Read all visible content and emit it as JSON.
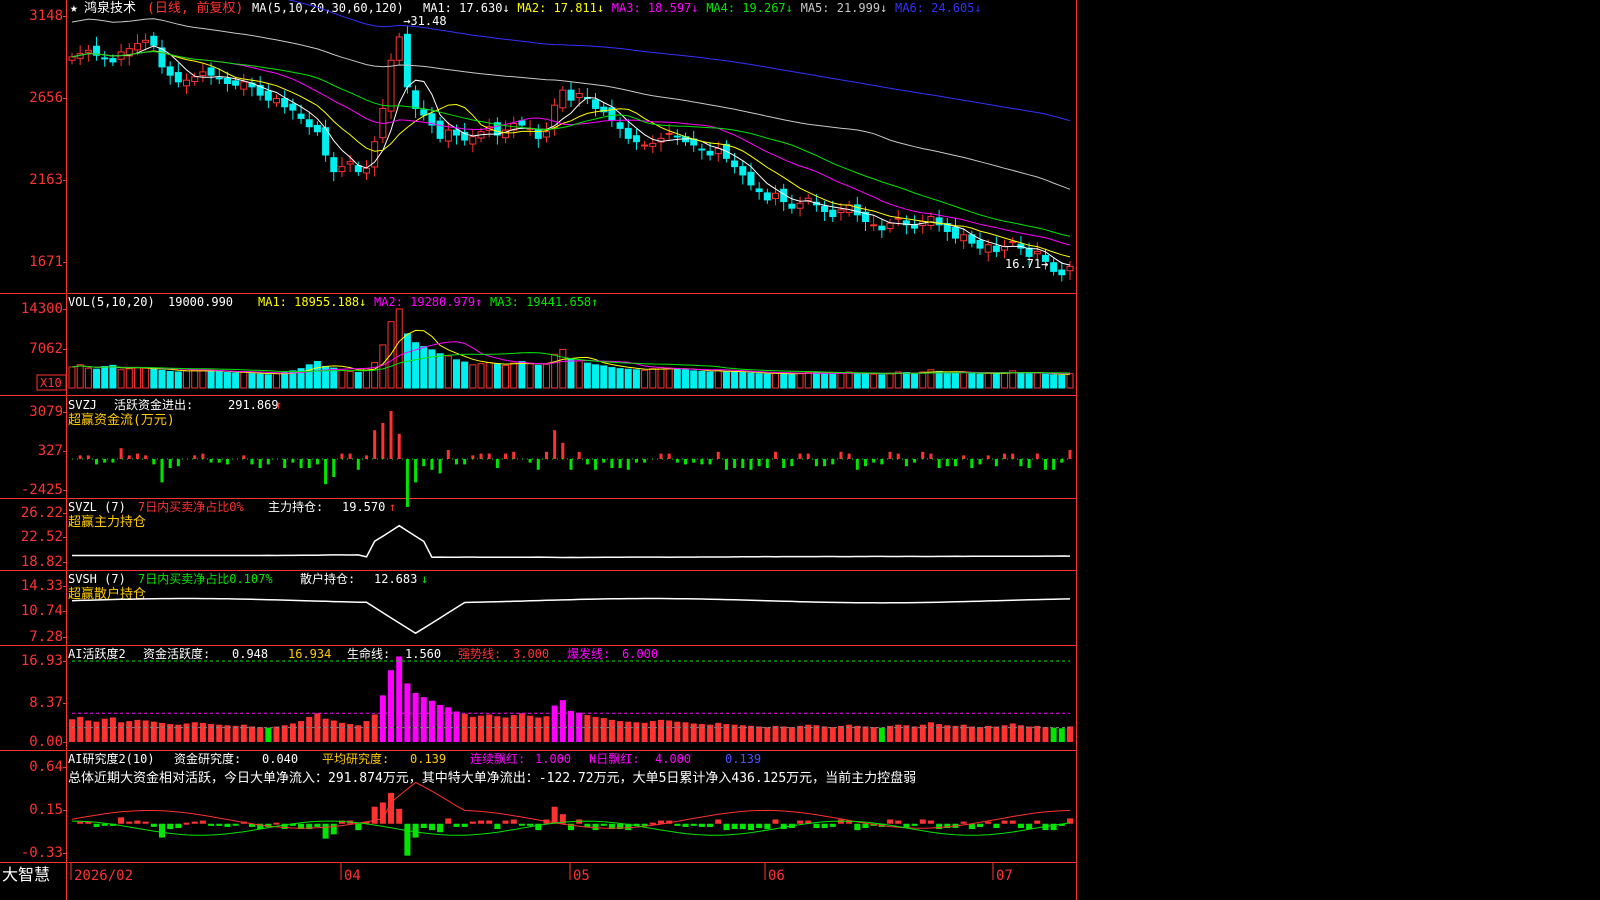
{
  "colors": {
    "up": "#ff3232",
    "down": "#00f0f0",
    "axis": "#ff3232",
    "ma1": "#ffffff",
    "ma2": "#ffff00",
    "ma3": "#ff00ff",
    "ma4": "#00e600",
    "ma5": "#c8c8c8",
    "ma6": "#3232ff",
    "green": "#00e600",
    "magenta": "#ff00ff",
    "gold": "#ffcc00",
    "grid": "#8b0000"
  },
  "header": {
    "stock_name": "鸿泉技术",
    "mode": "(日线, 前复权)",
    "ma_label": "MA(5,10,20,30,60,120)",
    "ma": [
      {
        "k": "MA1:",
        "v": "17.630",
        "arrow": "↓"
      },
      {
        "k": "MA2:",
        "v": "17.811",
        "arrow": "↓"
      },
      {
        "k": "MA3:",
        "v": "18.597",
        "arrow": "↓"
      },
      {
        "k": "MA4:",
        "v": "19.267",
        "arrow": "↓"
      },
      {
        "k": "MA5:",
        "v": "21.999",
        "arrow": "↓"
      },
      {
        "k": "MA6:",
        "v": "24.605",
        "arrow": "↓"
      }
    ]
  },
  "price_axis": [
    "3148",
    "2656",
    "2163",
    "1671"
  ],
  "price_notes": {
    "high": "31.48",
    "low": "16.71"
  },
  "vol": {
    "label": "VOL(5,10,20)",
    "value": "19000.990",
    "ma": [
      {
        "k": "MA1:",
        "v": "18955.188",
        "arrow": "↓"
      },
      {
        "k": "MA2:",
        "v": "19280.979",
        "arrow": "↑"
      },
      {
        "k": "MA3:",
        "v": "19441.658",
        "arrow": "↑"
      }
    ],
    "axis": [
      "14300",
      "7062"
    ],
    "multiplier": "X10"
  },
  "svzj": {
    "label": "SVZJ",
    "desc": "活跃资金进出:",
    "value": "291.869",
    "arrow": "↑",
    "sub": "超赢资金流(万元)",
    "axis": [
      "3079",
      "327",
      "-2425"
    ]
  },
  "svzl": {
    "label": "SVZL (7)",
    "pct": "7日内买卖净占比0%",
    "hold_label": "主力持仓:",
    "hold": "19.570",
    "arrow": "↑",
    "sub": "超赢主力持仓",
    "axis": [
      "26.22",
      "22.52",
      "18.82"
    ]
  },
  "svsh": {
    "label": "SVSH (7)",
    "pct": "7日内买卖净占比0.107%",
    "hold_label": "散户持仓:",
    "hold": "12.683",
    "arrow": "↓",
    "sub": "超赢散户持仓",
    "axis": [
      "14.33",
      "10.74",
      "7.28"
    ]
  },
  "ai_act": {
    "label": "AI活跃度2",
    "desc": "资金活跃度:",
    "value": "0.948",
    "value2": "16.934",
    "life_label": "生命线:",
    "life": "1.560",
    "strong_label": "强势线:",
    "strong": "3.000",
    "burst_label": "爆发线:",
    "burst": "6.000",
    "axis": [
      "16.93",
      "8.37",
      "0.00"
    ]
  },
  "ai_res": {
    "label": "AI研究度2(10)",
    "desc": "资金研究度:",
    "value": "0.040",
    "avg_label": "平均研究度:",
    "avg": "0.139",
    "cont_label": "连续飘红:",
    "cont": "1.000",
    "n_label": "N日飘红:",
    "n": "4.000",
    "last": "0.139",
    "summary": "总体近期大资金相对活跃，今日大单净流入：291.874万元，其中特大单净流出：-122.72万元，大单5日累计净入436.125万元，当前主力控盘弱",
    "axis": [
      "0.64",
      "0.15",
      "-0.33"
    ]
  },
  "footer": {
    "brand": "大智慧",
    "dates": [
      "2026/02",
      "04",
      "05",
      "06",
      "07"
    ]
  },
  "chart_data": {
    "type": "candlestick",
    "closes": [
      30.1,
      30.3,
      30.5,
      30.2,
      30.0,
      29.8,
      30.4,
      30.6,
      30.9,
      31.1,
      30.8,
      29.5,
      29.0,
      28.6,
      28.7,
      28.9,
      29.2,
      29.0,
      28.8,
      28.5,
      28.4,
      28.6,
      28.3,
      27.8,
      27.5,
      27.6,
      27.1,
      26.9,
      26.4,
      25.9,
      25.6,
      24.2,
      23.2,
      23.5,
      23.8,
      23.2,
      23.4,
      25.0,
      27.0,
      29.9,
      31.3,
      28.3,
      27.0,
      26.6,
      26.0,
      25.2,
      25.7,
      25.4,
      25.1,
      25.3,
      25.6,
      25.9,
      25.4,
      25.7,
      26.1,
      26.0,
      25.8,
      25.2,
      25.6,
      27.2,
      28.1,
      27.5,
      27.9,
      27.6,
      27.0,
      26.8,
      26.3,
      25.8,
      25.2,
      25.0,
      24.8,
      24.9,
      25.2,
      25.5,
      25.3,
      25.0,
      24.8,
      24.5,
      24.2,
      24.6,
      24.0,
      23.5,
      23.0,
      22.4,
      22.0,
      21.5,
      21.9,
      21.4,
      21.0,
      21.3,
      21.6,
      21.2,
      20.8,
      20.5,
      20.9,
      21.2,
      20.6,
      20.2,
      20.0,
      19.7,
      20.1,
      20.4,
      20.0,
      19.8,
      20.2,
      20.5,
      20.0,
      19.6,
      19.2,
      19.4,
      18.9,
      18.6,
      18.8,
      18.4,
      18.7,
      19.0,
      18.6,
      18.1,
      18.4,
      17.8,
      17.2,
      17.0,
      17.5
    ],
    "volumes": [
      3800,
      4200,
      3600,
      3400,
      3900,
      4100,
      3300,
      3500,
      3700,
      3600,
      3400,
      3200,
      3000,
      2900,
      3100,
      3300,
      3200,
      3000,
      2900,
      2800,
      2700,
      2900,
      2600,
      2500,
      2400,
      2600,
      2800,
      3100,
      3500,
      4200,
      4800,
      3900,
      3600,
      3200,
      3000,
      2800,
      3500,
      4600,
      7800,
      12000,
      14300,
      9800,
      8200,
      7500,
      6900,
      6200,
      5800,
      5100,
      4700,
      4200,
      4400,
      4600,
      4300,
      4100,
      4500,
      4800,
      4400,
      4100,
      4300,
      6100,
      7000,
      5200,
      4900,
      4500,
      4200,
      4000,
      3700,
      3500,
      3400,
      3300,
      3200,
      3500,
      3700,
      3600,
      3400,
      3300,
      3100,
      3000,
      2900,
      3200,
      3000,
      2900,
      2800,
      2700,
      2600,
      2500,
      2700,
      2600,
      2500,
      2700,
      2900,
      2800,
      2600,
      2500,
      2700,
      2900,
      2700,
      2600,
      2500,
      2400,
      2700,
      2900,
      2800,
      2600,
      2900,
      3300,
      3000,
      2800,
      2700,
      2900,
      2600,
      2500,
      2700,
      2600,
      2800,
      3100,
      2800,
      2600,
      2700,
      2500,
      2400,
      2300,
      2600
    ],
    "ylim": [
      16.2,
      32.2
    ]
  }
}
